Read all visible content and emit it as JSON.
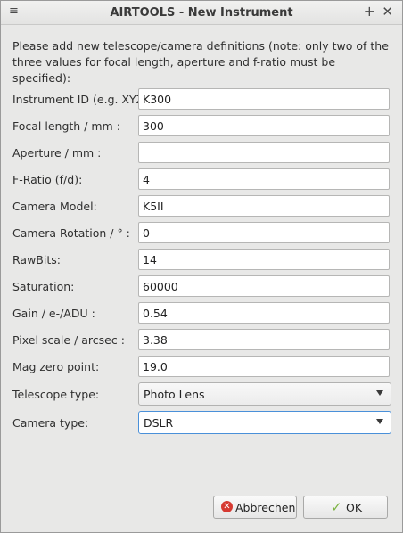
{
  "window": {
    "title": "AIRTOOLS - New Instrument",
    "menu_glyph": "≡",
    "maximize_glyph": "+",
    "close_glyph": "✕"
  },
  "intro": "Please add new telescope/camera definitions (note: only two of the three values for focal length, aperture and f-ratio must be specified):",
  "fields": [
    {
      "label": "Instrument ID (e.g. XYZ):",
      "value": "K300"
    },
    {
      "label": "Focal length / mm :",
      "value": "300"
    },
    {
      "label": "Aperture / mm :",
      "value": ""
    },
    {
      "label": "F-Ratio (f/d):",
      "value": "4"
    },
    {
      "label": "Camera Model:",
      "value": "K5II"
    },
    {
      "label": "Camera Rotation / ° :",
      "value": "0"
    },
    {
      "label": "RawBits:",
      "value": "14"
    },
    {
      "label": "Saturation:",
      "value": "60000"
    },
    {
      "label": "Gain / e-/ADU :",
      "value": "0.54"
    },
    {
      "label": "Pixel scale / arcsec :",
      "value": "3.38"
    },
    {
      "label": "Mag zero point:",
      "value": "19.0"
    }
  ],
  "telescope_type": {
    "label": "Telescope type:",
    "value": "Photo Lens"
  },
  "camera_type": {
    "label": "Camera type:",
    "value": "DSLR"
  },
  "buttons": {
    "cancel": {
      "label": "Abbrechen",
      "icon": "cancel-icon",
      "icon_glyph": "✕"
    },
    "ok": {
      "label": "OK",
      "icon": "checkmark-icon",
      "icon_glyph": "✓"
    }
  },
  "colors": {
    "background": "#e8e8e7",
    "focus_border": "#4a90d9",
    "cancel_icon": "#d63a32",
    "ok_icon": "#7cb342"
  }
}
